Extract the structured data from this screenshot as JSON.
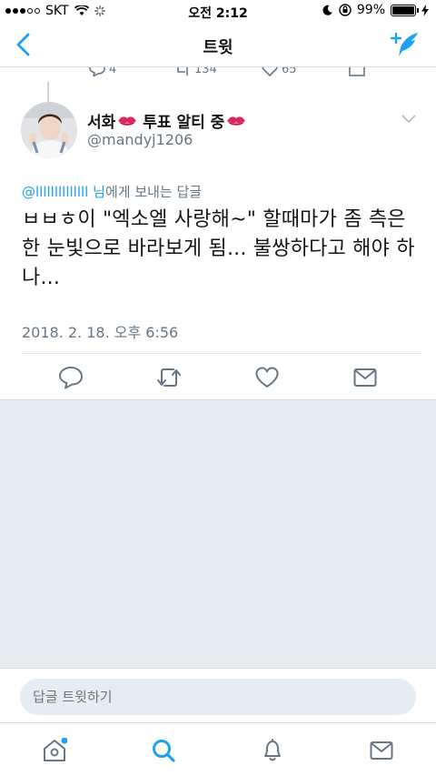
{
  "status_bar": {
    "carrier": "SKT",
    "time": "오전 2:12",
    "battery": "99%",
    "battery_level": 0.99
  },
  "nav": {
    "title": "트윗"
  },
  "prev_tweet": {
    "retweets": "134",
    "likes": "65",
    "replies": "4"
  },
  "tweet": {
    "display_name": "서화",
    "name_suffix": "투표 알티 중",
    "handle": "@mandyj1206",
    "reply_mention": "@llllllllllllll",
    "reply_honorific": "님",
    "reply_suffix": "에게 보내는 답글",
    "text": "ㅂㅂㅎ이 \"엑소엘 사랑해~\" 할때마가 좀 측은한 눈빛으로 바라보게 됨... 불쌍하다고 해야 하나...",
    "timestamp": "2018. 2. 18. 오후 6:56"
  },
  "reply": {
    "placeholder": "답글 트윗하기"
  },
  "colors": {
    "accent": "#1da1f2",
    "text_secondary": "#657786",
    "background": "#e6ecf0",
    "kiss": "#e0245e"
  },
  "icons": {
    "nav": [
      "back-chevron-icon",
      "compose-tweet-icon"
    ],
    "actions": [
      "reply-icon",
      "retweet-icon",
      "like-icon",
      "direct-message-icon"
    ],
    "tabs": [
      "home-icon",
      "search-icon",
      "notifications-icon",
      "messages-icon"
    ]
  }
}
